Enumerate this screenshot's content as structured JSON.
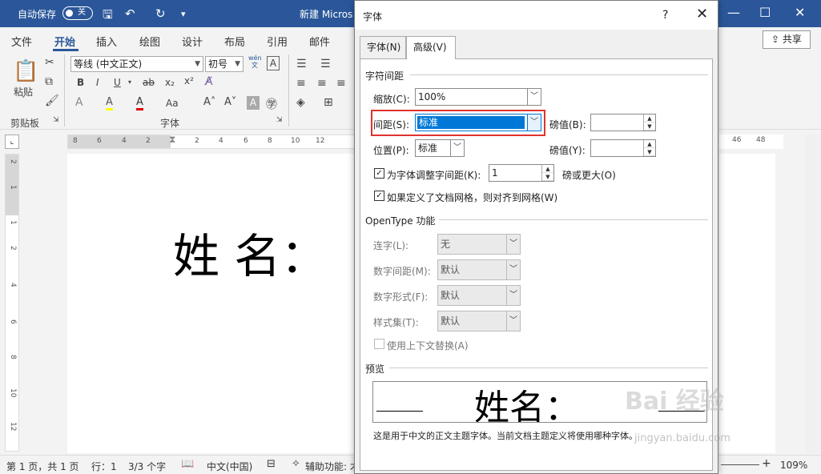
{
  "titlebar": {
    "autosave": "自动保存",
    "toggle": "关",
    "doc": "新建 Micros"
  },
  "ribbon_tabs": [
    "文件",
    "开始",
    "插入",
    "绘图",
    "设计",
    "布局",
    "引用",
    "邮件"
  ],
  "share": "共享",
  "ribbon": {
    "paste": "粘贴",
    "font_name": "等线 (中文正文)",
    "font_size": "初号",
    "clipboard_label": "剪贴板",
    "font_label": "字体",
    "bold": "B",
    "italic": "I",
    "underline": "U",
    "strike": "ab",
    "sub": "x₂",
    "sup": "x²",
    "aa": "Aa",
    "grow": "A^",
    "shrink": "A˅",
    "highlight": "A",
    "fontcolor": "A",
    "wen": "wén\n文"
  },
  "ruler_h": [
    "8",
    "6",
    "4",
    "2",
    "2",
    "4",
    "6",
    "8",
    "10",
    "12"
  ],
  "ruler_h_right": [
    "46",
    "48"
  ],
  "ruler_v": [
    "2",
    "1",
    "1",
    "2",
    "4",
    "6",
    "8",
    "10",
    "12"
  ],
  "document": {
    "text": "姓 名："
  },
  "status": {
    "page": "第 1 页，共 1 页",
    "row": "行：1",
    "chars": "3/3 个字",
    "lang": "中文(中国)",
    "access": "辅助功能: 才",
    "zoom": "109%"
  },
  "dialog": {
    "title": "字体",
    "help": "?",
    "close": "✕",
    "tabs": [
      "字体(N)",
      "高级(V)"
    ],
    "spacing_section": "字符间距",
    "scale_label": "缩放(C):",
    "scale_value": "100%",
    "spacing_label": "间距(S):",
    "spacing_value": "标准",
    "pt1_label": "磅值(B):",
    "position_label": "位置(P):",
    "position_value": "标准",
    "pt2_label": "磅值(Y):",
    "kern_label": "为字体调整字间距(K):",
    "kern_value": "1",
    "kern_suffix": "磅或更大(O)",
    "grid_label": "如果定义了文档网格，则对齐到网格(W)",
    "opentype_section": "OpenType 功能",
    "ligature_label": "连字(L):",
    "ligature_value": "无",
    "numspacing_label": "数字间距(M):",
    "numspacing_value": "默认",
    "numform_label": "数字形式(F):",
    "numform_value": "默认",
    "styleset_label": "样式集(T):",
    "styleset_value": "默认",
    "contextual_label": "使用上下文替换(A)",
    "preview_section": "预览",
    "preview_text": "姓名：",
    "preview_note": "这是用于中文的正文主题字体。当前文档主题定义将使用哪种字体。"
  },
  "watermark": {
    "main": "Bai 经验",
    "sub": "jingyan.baidu.com"
  }
}
